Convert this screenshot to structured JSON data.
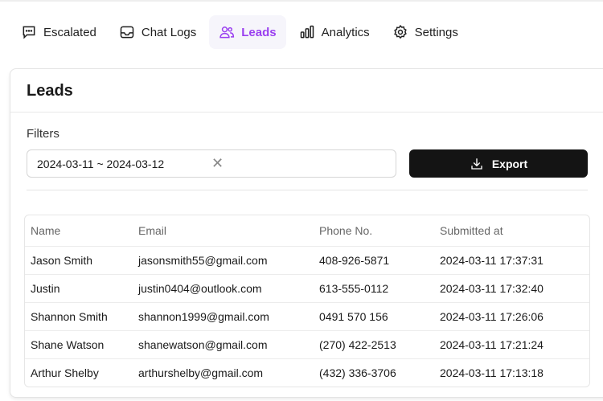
{
  "nav": {
    "tabs": [
      {
        "label": "Escalated",
        "icon": "chat-bubble-icon"
      },
      {
        "label": "Chat Logs",
        "icon": "inbox-icon"
      },
      {
        "label": "Leads",
        "icon": "users-icon",
        "active": true
      },
      {
        "label": "Analytics",
        "icon": "bar-chart-icon"
      },
      {
        "label": "Settings",
        "icon": "gear-icon"
      }
    ]
  },
  "accent": "#9a3ff0",
  "page": {
    "title": "Leads",
    "filters_label": "Filters",
    "date_range": "2024-03-11 ~ 2024-03-12",
    "export_label": "Export"
  },
  "table": {
    "headers": [
      "Name",
      "Email",
      "Phone No.",
      "Submitted at"
    ],
    "rows": [
      [
        "Jason Smith",
        "jasonsmith55@gmail.com",
        "408-926-5871",
        "2024-03-11 17:37:31"
      ],
      [
        "Justin",
        "justin0404@outlook.com",
        "613-555-0112",
        "2024-03-11 17:32:40"
      ],
      [
        "Shannon Smith",
        "shannon1999@gmail.com",
        "0491 570 156",
        "2024-03-11 17:26:06"
      ],
      [
        "Shane Watson",
        "shanewatson@gmail.com",
        "(270) 422-2513",
        "2024-03-11 17:21:24"
      ],
      [
        "Arthur Shelby",
        "arthurshelby@gmail.com",
        "(432) 336-3706",
        "2024-03-11 17:13:18"
      ]
    ]
  }
}
